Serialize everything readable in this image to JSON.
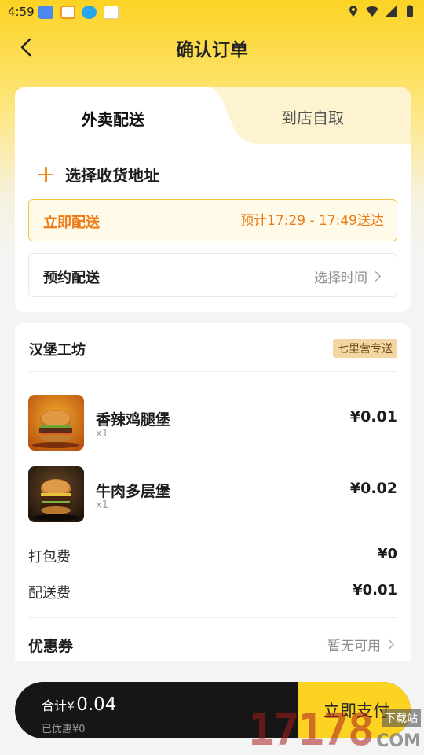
{
  "status_bar": {
    "time": "4:59"
  },
  "header": {
    "title": "确认订单"
  },
  "tabs": [
    {
      "label": "外卖配送"
    },
    {
      "label": "到店自取"
    }
  ],
  "address": {
    "add_label": "选择收货地址"
  },
  "delivery_options": {
    "now_label": "立即配送",
    "now_time": "预计17:29 - 17:49送达",
    "schedule_label": "预约配送",
    "schedule_action": "选择时间"
  },
  "store": {
    "name": "汉堡工坊",
    "badge": "七里营专送"
  },
  "items": [
    {
      "name": "香辣鸡腿堡",
      "qty": "x1",
      "price": "¥0.01"
    },
    {
      "name": "牛肉多层堡",
      "qty": "x1",
      "price": "¥0.02"
    }
  ],
  "fees": [
    {
      "label": "打包费",
      "value": "¥0"
    },
    {
      "label": "配送费",
      "value": "¥0.01"
    }
  ],
  "coupon": {
    "label": "优惠券",
    "value": "暂无可用"
  },
  "bottom_bar": {
    "total_label": "合计¥",
    "total_value": "0.04",
    "discount": "已优惠¥0",
    "pay_label": "立即支付"
  },
  "watermark": {
    "number": "17178",
    "text": "下载站",
    "domain": "COM"
  },
  "colors": {
    "brand_yellow": "#fcd323",
    "accent_orange": "#ee7a16",
    "bar_dark": "#161616"
  }
}
